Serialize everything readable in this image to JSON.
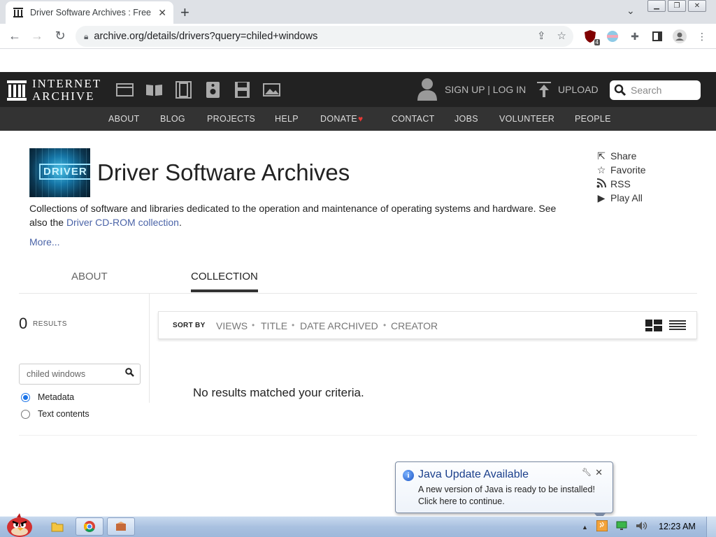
{
  "browser": {
    "tab_title": "Driver Software Archives : Free",
    "url": "archive.org/details/drivers?query=chiled+windows",
    "ext_badge": "4"
  },
  "ia": {
    "logo_line1": "INTERNET",
    "logo_line2": "ARCHIVE",
    "signup": "SIGN UP | LOG IN",
    "upload": "UPLOAD",
    "search_placeholder": "Search",
    "nav": [
      "ABOUT",
      "BLOG",
      "PROJECTS",
      "HELP",
      "DONATE",
      "CONTACT",
      "JOBS",
      "VOLUNTEER",
      "PEOPLE"
    ]
  },
  "collection": {
    "thumb_label": "DRIVER",
    "title": "Driver Software Archives",
    "description": "Collections of software and libraries dedicated to the operation and maintenance of operating systems and hardware. See also the",
    "desc_link": "Driver CD-ROM collection",
    "desc_end": ".",
    "more": "More...",
    "actions": [
      "Share",
      "Favorite",
      "RSS",
      "Play All"
    ]
  },
  "tabs": {
    "about": "ABOUT",
    "collection": "COLLECTION"
  },
  "results": {
    "count": "0",
    "count_label": "RESULTS",
    "sort_label": "SORT BY",
    "sort_options": [
      "VIEWS",
      "TITLE",
      "DATE ARCHIVED",
      "CREATOR"
    ],
    "search_value": "chiled windows",
    "radio_metadata": "Metadata",
    "radio_text": "Text contents",
    "no_results": "No results matched your criteria."
  },
  "java": {
    "title": "Java Update Available",
    "line1": "A new version of Java is ready to be installed!",
    "line2": "Click here to continue."
  },
  "taskbar": {
    "clock": "12:23 AM"
  },
  "colors": {
    "ia_dark": "#222222",
    "ia_nav": "#333333",
    "link": "#4b64a8",
    "donate_heart": "#e53935"
  }
}
